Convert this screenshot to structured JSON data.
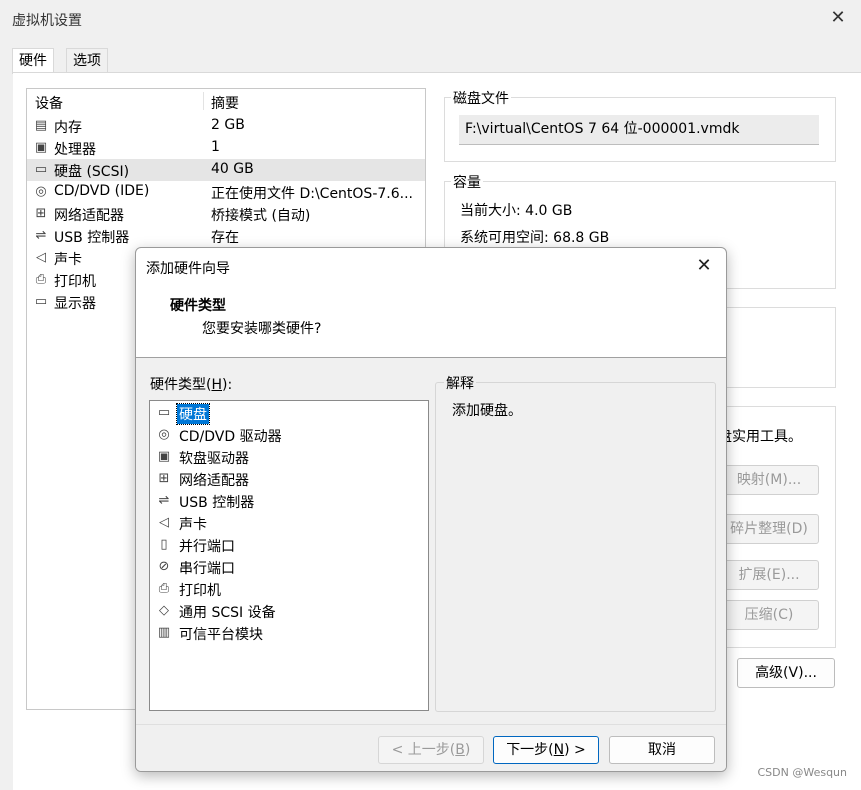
{
  "window": {
    "title": "虚拟机设置",
    "close_glyph": "✕"
  },
  "tabs": [
    {
      "label": "硬件"
    },
    {
      "label": "选项"
    }
  ],
  "device_list": {
    "columns": {
      "device": "设备",
      "summary": "摘要"
    },
    "rows": [
      {
        "name": "内存",
        "summary": "2 GB",
        "icon": "memory-icon"
      },
      {
        "name": "处理器",
        "summary": "1",
        "icon": "processor-icon"
      },
      {
        "name": "硬盘 (SCSI)",
        "summary": "40 GB",
        "icon": "harddisk-icon",
        "selected": true
      },
      {
        "name": "CD/DVD (IDE)",
        "summary": "正在使用文件 D:\\CentOS-7.6...",
        "icon": "cd-dvd-icon"
      },
      {
        "name": "网络适配器",
        "summary": "桥接模式 (自动)",
        "icon": "network-adapter-icon"
      },
      {
        "name": "USB 控制器",
        "summary": "存在",
        "icon": "usb-icon"
      },
      {
        "name": "声卡",
        "summary": "",
        "icon": "sound-card-icon"
      },
      {
        "name": "打印机",
        "summary": "",
        "icon": "printer-icon"
      },
      {
        "name": "显示器",
        "summary": "",
        "icon": "display-icon"
      }
    ]
  },
  "disk_file": {
    "label": "磁盘文件",
    "value": "F:\\virtual\\CentOS 7 64 位-000001.vmdk"
  },
  "capacity": {
    "label": "容量",
    "current_size": "当前大小: 4.0 GB",
    "free_space": "系统可用空间: 68.8 GB"
  },
  "disk_utilities": {
    "text": "盘实用工具。",
    "buttons": {
      "map": "映射(M)...",
      "defrag": "碎片整理(D)",
      "expand": "扩展(E)...",
      "compact": "压缩(C)"
    }
  },
  "advanced_button": "高级(V)...",
  "watermark": "CSDN @Wesqun",
  "dialog": {
    "title": "添加硬件向导",
    "close_glyph": "✕",
    "header_title": "硬件类型",
    "header_subtitle": "您要安装哪类硬件?",
    "hw_label_pre": "硬件类型(",
    "hw_label_key": "H",
    "hw_label_post": "):",
    "hardware_types": [
      {
        "name": "硬盘",
        "icon": "harddisk-icon",
        "selected": true
      },
      {
        "name": "CD/DVD 驱动器",
        "icon": "cd-dvd-icon"
      },
      {
        "name": "软盘驱动器",
        "icon": "floppy-icon"
      },
      {
        "name": "网络适配器",
        "icon": "network-adapter-icon"
      },
      {
        "name": "USB 控制器",
        "icon": "usb-icon"
      },
      {
        "name": "声卡",
        "icon": "sound-card-icon"
      },
      {
        "name": "并行端口",
        "icon": "parallel-port-icon"
      },
      {
        "name": "串行端口",
        "icon": "serial-port-icon"
      },
      {
        "name": "打印机",
        "icon": "printer-icon"
      },
      {
        "name": "通用 SCSI 设备",
        "icon": "scsi-device-icon"
      },
      {
        "name": "可信平台模块",
        "icon": "tpm-icon"
      }
    ],
    "explain_label": "解释",
    "explain_text": "添加硬盘。",
    "buttons": {
      "back_pre": "< 上一步(",
      "back_key": "B",
      "back_post": ")",
      "next_pre": "下一步(",
      "next_key": "N",
      "next_post": ") >",
      "cancel": "取消"
    }
  }
}
